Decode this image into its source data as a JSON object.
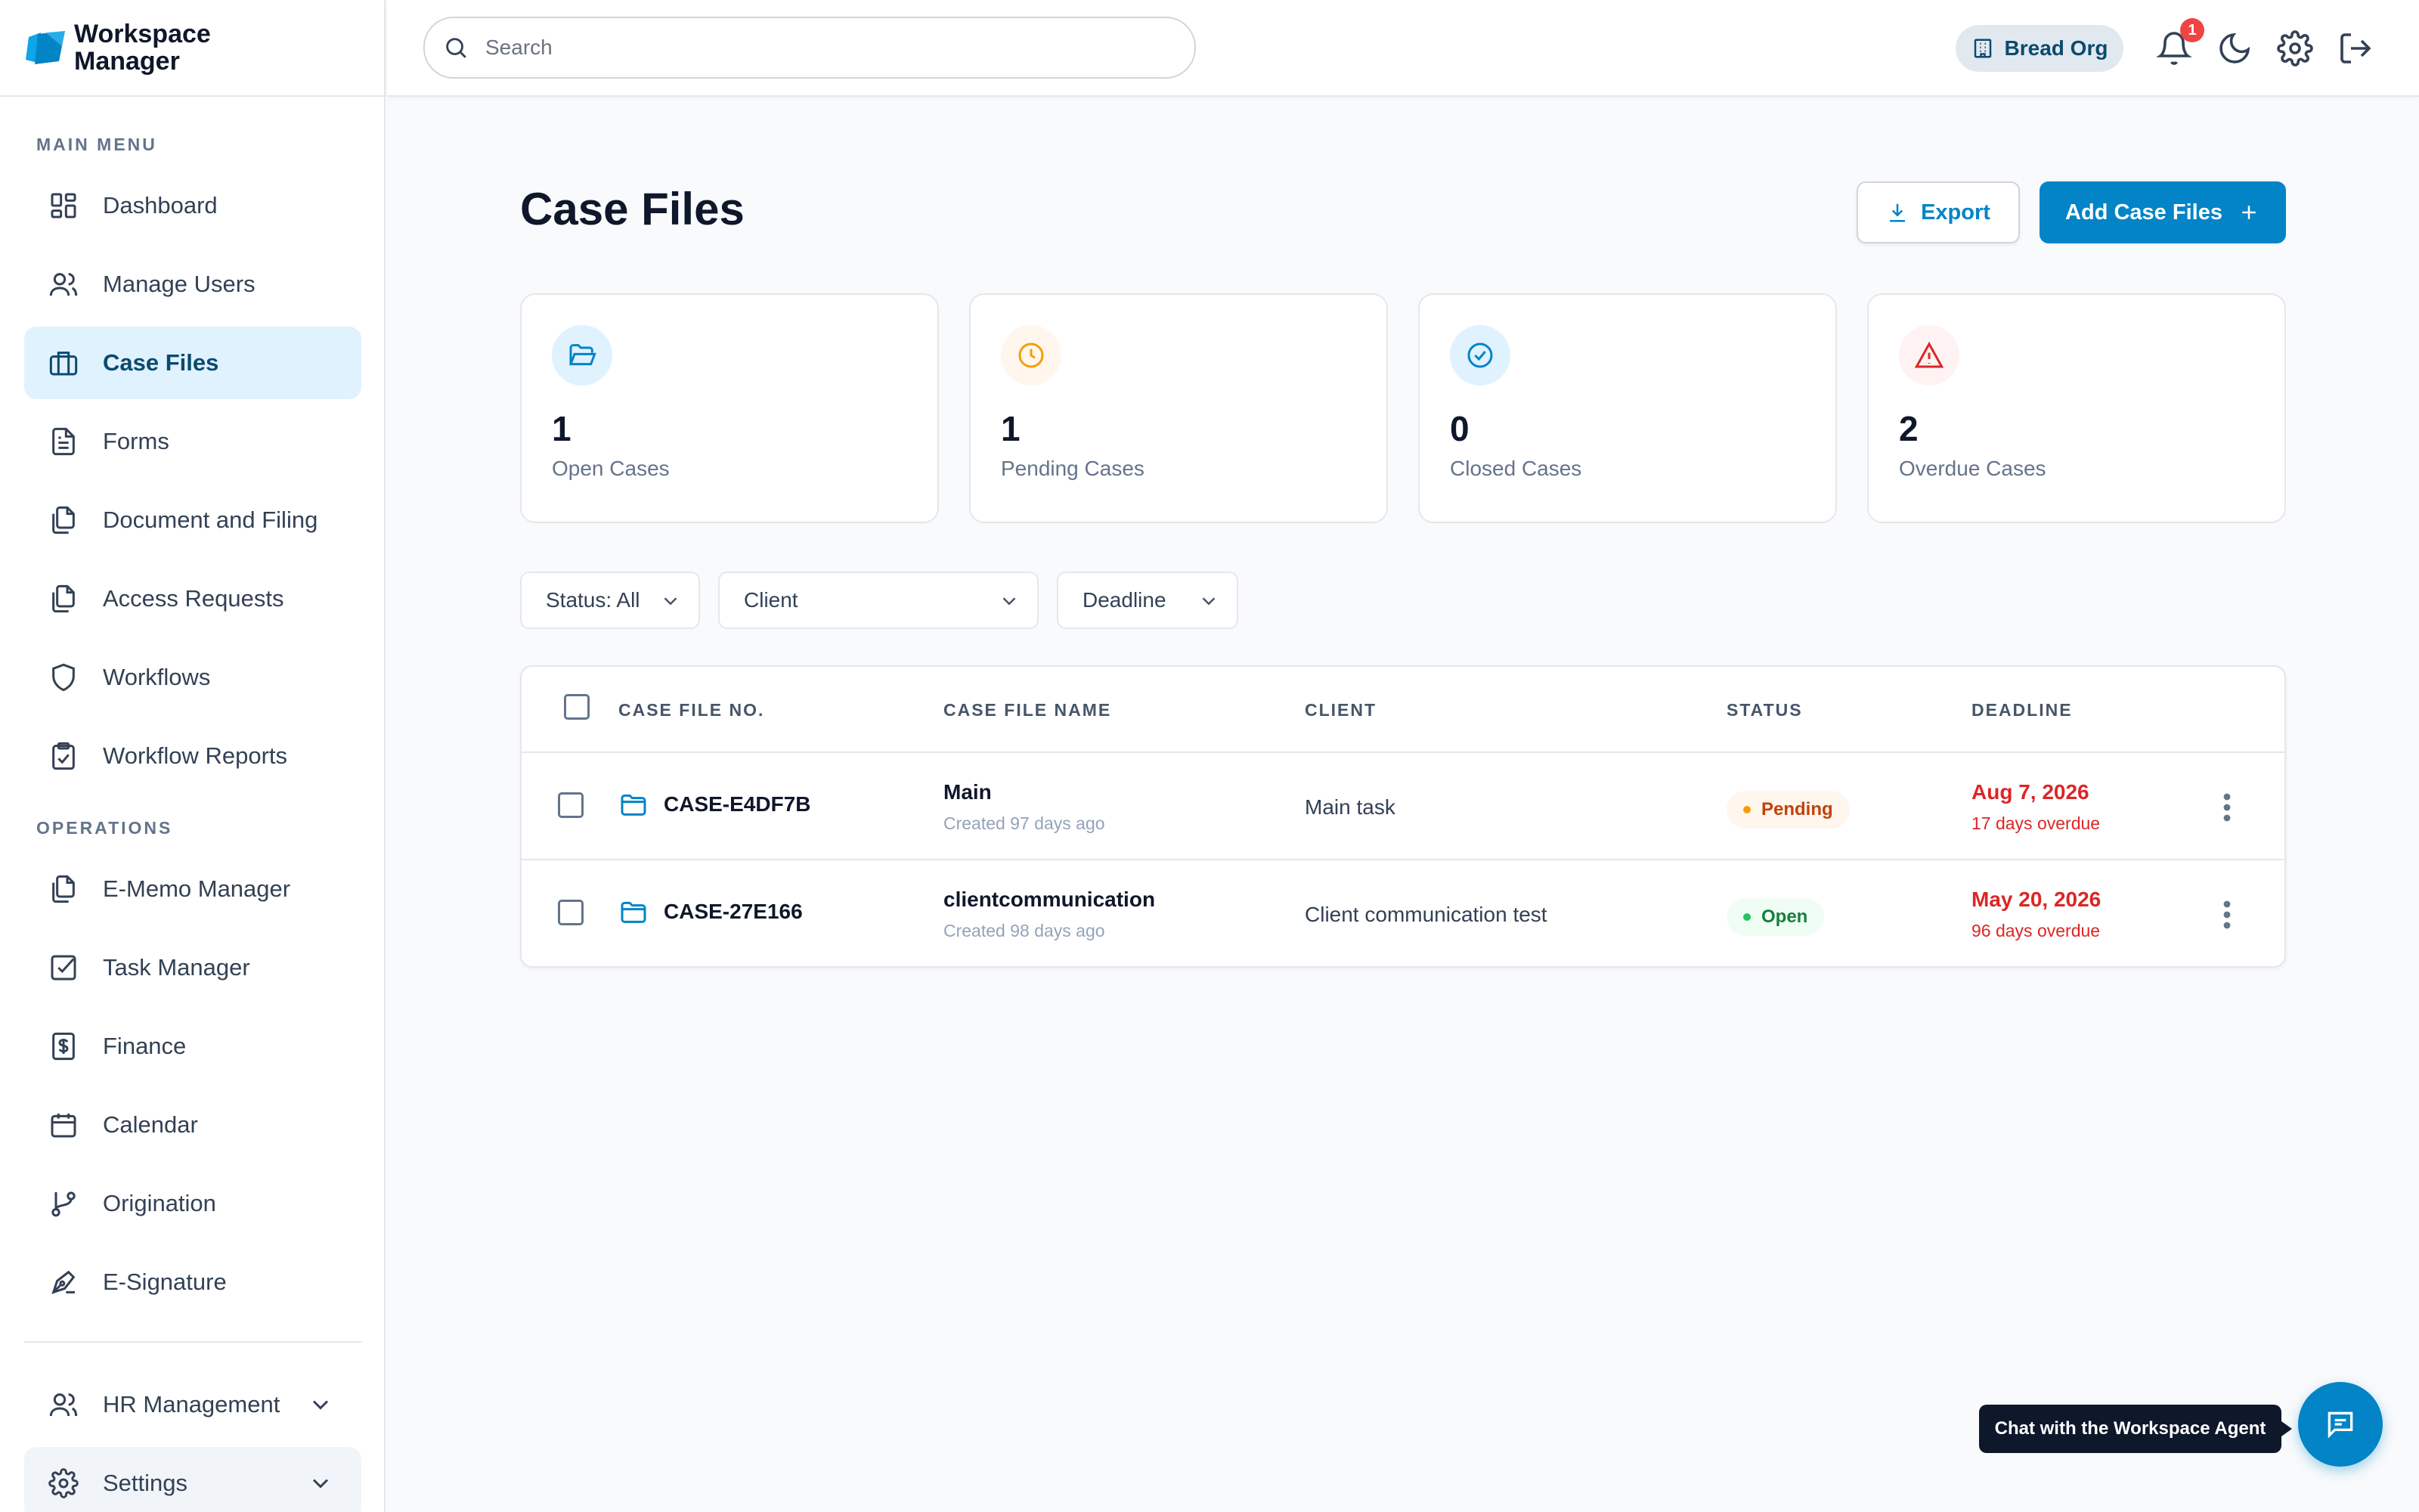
{
  "brand": {
    "line1": "Workspace",
    "line2": "Manager"
  },
  "sidebar": {
    "main_menu_label": "MAIN MENU",
    "operations_label": "OPERATIONS",
    "main_items": [
      {
        "label": "Dashboard",
        "icon": "dashboard-icon"
      },
      {
        "label": "Manage Users",
        "icon": "users-icon"
      },
      {
        "label": "Case Files",
        "icon": "briefcase-icon",
        "active": true
      },
      {
        "label": "Forms",
        "icon": "form-icon"
      },
      {
        "label": "Document and Filing",
        "icon": "documents-icon"
      },
      {
        "label": "Access Requests",
        "icon": "documents-icon"
      },
      {
        "label": "Workflows",
        "icon": "shield-icon"
      },
      {
        "label": "Workflow Reports",
        "icon": "clipboard-check-icon"
      }
    ],
    "ops_items": [
      {
        "label": "E-Memo Manager",
        "icon": "documents-icon"
      },
      {
        "label": "Task Manager",
        "icon": "checkbox-icon"
      },
      {
        "label": "Finance",
        "icon": "dollar-icon"
      },
      {
        "label": "Calendar",
        "icon": "calendar-icon"
      },
      {
        "label": "Origination",
        "icon": "git-branch-icon"
      },
      {
        "label": "E-Signature",
        "icon": "pen-icon"
      }
    ],
    "bottom_items": [
      {
        "label": "HR Management",
        "icon": "users-icon"
      },
      {
        "label": "Settings",
        "icon": "gear-icon"
      }
    ]
  },
  "header": {
    "search_placeholder": "Search",
    "org_name": "Bread Org",
    "notification_count": "1"
  },
  "page": {
    "title": "Case Files",
    "export_label": "Export",
    "add_label": "Add Case Files"
  },
  "stats": [
    {
      "value": "1",
      "label": "Open Cases",
      "color": "#0284c7"
    },
    {
      "value": "1",
      "label": "Pending Cases",
      "color": "#f59e0b"
    },
    {
      "value": "0",
      "label": "Closed Cases",
      "color": "#0284c7"
    },
    {
      "value": "2",
      "label": "Overdue Cases",
      "color": "#dc2626"
    }
  ],
  "filters": {
    "status": "Status: All",
    "client": "Client",
    "deadline": "Deadline"
  },
  "table": {
    "columns": [
      "CASE FILE NO.",
      "CASE FILE NAME",
      "CLIENT",
      "STATUS",
      "DEADLINE"
    ],
    "rows": [
      {
        "case_no": "CASE-E4DF7B",
        "name": "Main",
        "created": "Created 97 days ago",
        "client": "Main task",
        "status": "Pending",
        "deadline": "Aug 7, 2026",
        "overdue": "17 days overdue"
      },
      {
        "case_no": "CASE-27E166",
        "name": "clientcommunication",
        "created": "Created 98 days ago",
        "client": "Client communication test",
        "status": "Open",
        "deadline": "May 20, 2026",
        "overdue": "96 days overdue"
      }
    ]
  },
  "chat": {
    "tooltip": "Chat with the Workspace Agent"
  },
  "colors": {
    "accent": "#0284c7",
    "danger": "#dc2626",
    "warning": "#f59e0b",
    "success": "#22c55e"
  }
}
